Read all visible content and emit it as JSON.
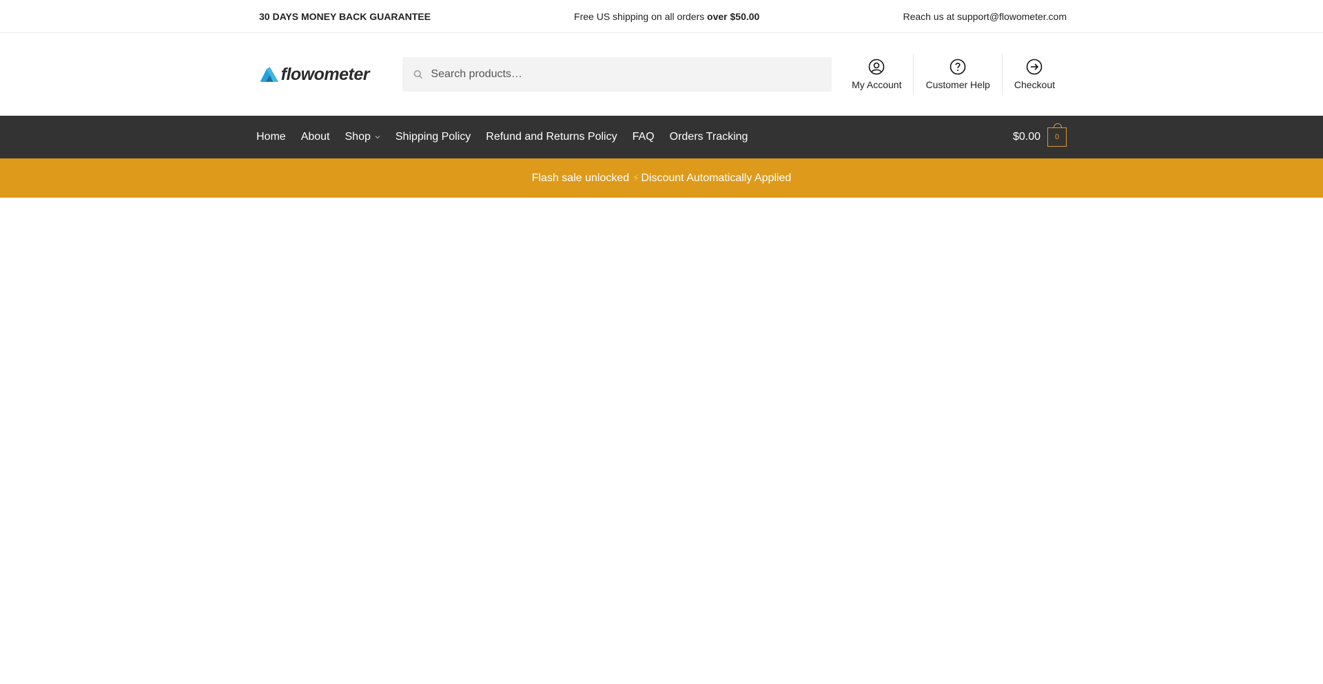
{
  "topbar": {
    "guarantee": "30 DAYS MONEY BACK GUARANTEE",
    "shipping_prefix": "Free US shipping on all orders ",
    "shipping_bold": "over $50.00",
    "contact": "Reach us at support@flowometer.com"
  },
  "header": {
    "logo_text": "flowometer",
    "search_placeholder": "Search products…",
    "links": {
      "account": "My Account",
      "help": "Customer Help",
      "checkout": "Checkout"
    }
  },
  "nav": {
    "items": {
      "home": "Home",
      "about": "About",
      "shop": "Shop",
      "shipping": "Shipping Policy",
      "refund": "Refund and Returns Policy",
      "faq": "FAQ",
      "tracking": "Orders Tracking"
    },
    "cart_total": "$0.00",
    "cart_count": "0"
  },
  "banner": {
    "text_before": "Flash sale unlocked ",
    "bolt": "⚡",
    "text_after": "Discount Automatically Applied"
  },
  "colors": {
    "nav_bg": "#333333",
    "banner_bg": "#dd9a1b",
    "accent": "#dd9933",
    "logo_blue": "#2a9fd8"
  },
  "icons": [
    "search-icon",
    "user-circle-icon",
    "help-circle-icon",
    "arrow-circle-right-icon",
    "chevron-down-icon",
    "bolt-icon"
  ]
}
